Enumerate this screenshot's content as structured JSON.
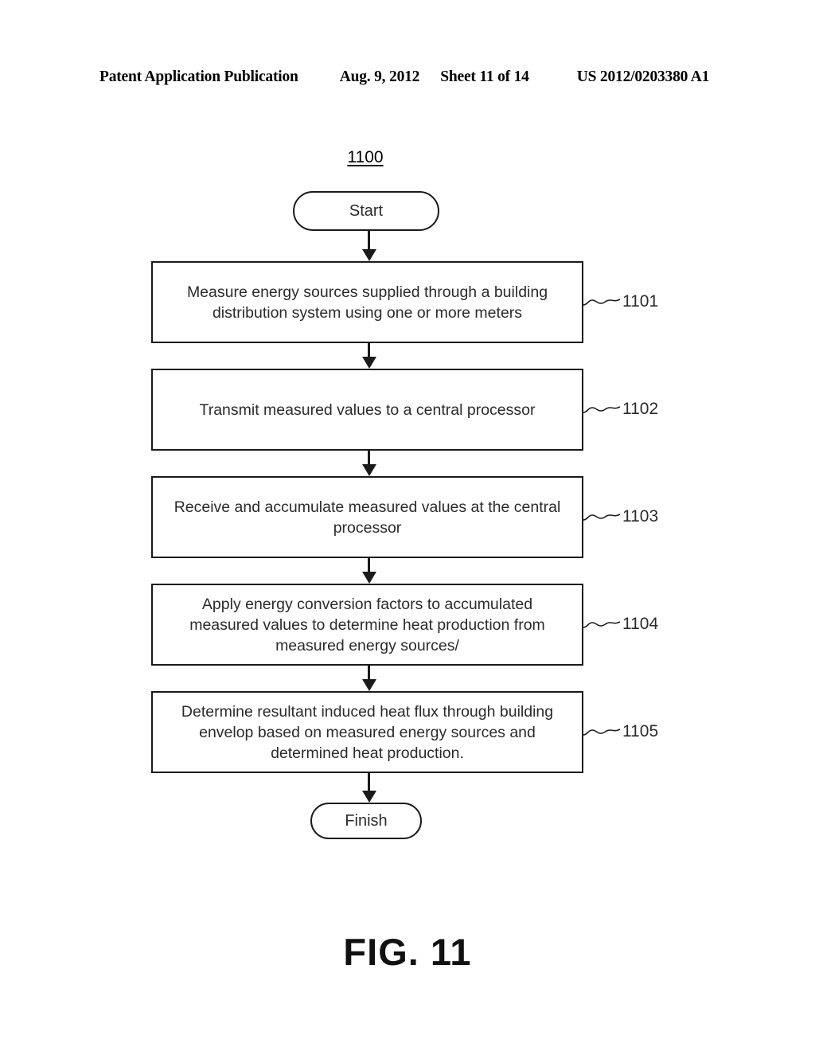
{
  "header": {
    "publication": "Patent Application Publication",
    "date": "Aug. 9, 2012",
    "sheet": "Sheet 11 of 14",
    "patent_number": "US 2012/0203380 A1"
  },
  "figure": {
    "diagram_number": "1100",
    "caption": "FIG. 11"
  },
  "flowchart": {
    "start_label": "Start",
    "finish_label": "Finish",
    "steps": [
      {
        "ref": "1101",
        "text": "Measure energy sources supplied through a building distribution system using one or more meters"
      },
      {
        "ref": "1102",
        "text": "Transmit measured values to a central processor"
      },
      {
        "ref": "1103",
        "text": "Receive and accumulate measured values at the central processor"
      },
      {
        "ref": "1104",
        "text": "Apply energy conversion factors to accumulated measured values to determine heat production from measured energy sources/"
      },
      {
        "ref": "1105",
        "text": "Determine resultant induced heat flux through building envelop based on measured energy sources and determined heat production."
      }
    ]
  },
  "colors": {
    "ink": "#1a1a1a",
    "text": "#2b2b2b",
    "background": "#ffffff"
  }
}
